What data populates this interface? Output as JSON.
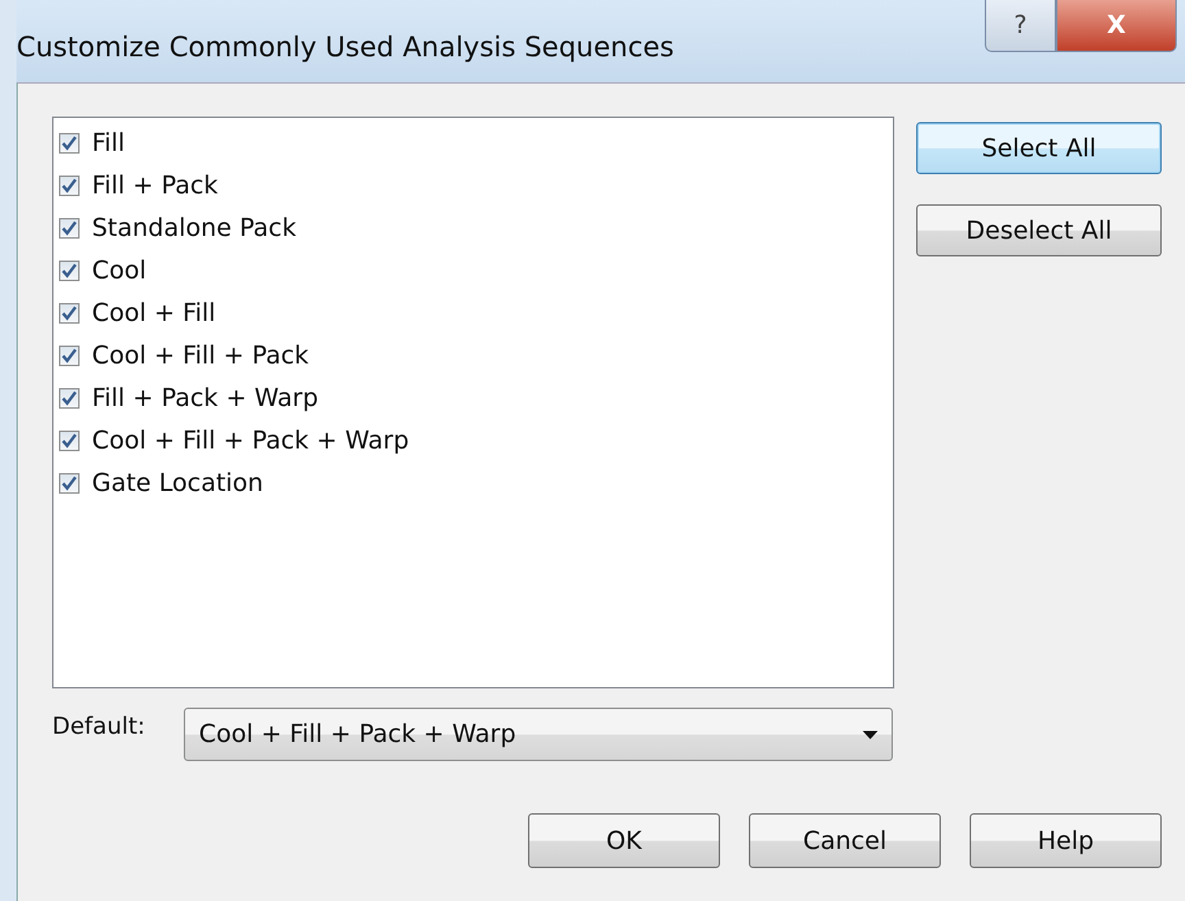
{
  "window": {
    "title": "Customize Commonly Used Analysis Sequences",
    "title_buttons": [
      "?",
      "X"
    ]
  },
  "sequences": [
    {
      "label": "Fill",
      "checked": true
    },
    {
      "label": "Fill + Pack",
      "checked": true
    },
    {
      "label": "Standalone Pack",
      "checked": true
    },
    {
      "label": "Cool",
      "checked": true
    },
    {
      "label": "Cool + Fill",
      "checked": true
    },
    {
      "label": "Cool + Fill + Pack",
      "checked": true
    },
    {
      "label": "Fill + Pack + Warp",
      "checked": true
    },
    {
      "label": "Cool + Fill + Pack + Warp",
      "checked": true
    },
    {
      "label": "Gate Location",
      "checked": true
    }
  ],
  "side_buttons": [
    {
      "label": "Select All",
      "focused": true
    },
    {
      "label": "Deselect All",
      "focused": false
    }
  ],
  "default": {
    "label": "Default:",
    "value": "Cool + Fill + Pack + Warp"
  },
  "buttons": [
    "OK",
    "Cancel",
    "Help"
  ]
}
